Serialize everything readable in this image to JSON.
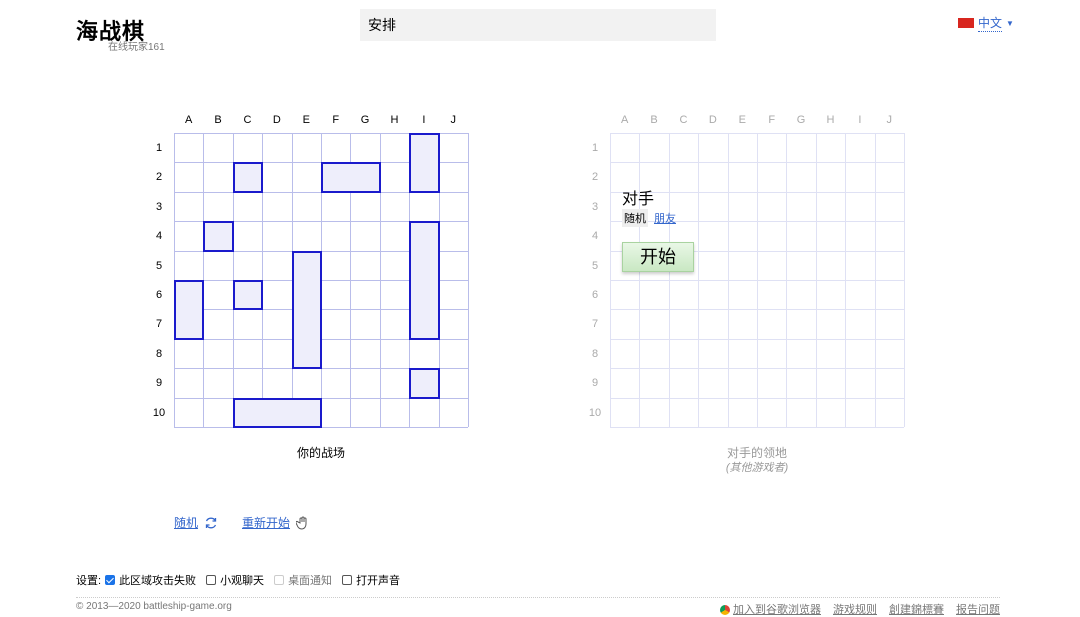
{
  "header": {
    "title": "海战棋",
    "online": "在线玩家161",
    "status": "安排",
    "language": "中文"
  },
  "boards": {
    "columns": [
      "A",
      "B",
      "C",
      "D",
      "E",
      "F",
      "G",
      "H",
      "I",
      "J"
    ],
    "rows": [
      "1",
      "2",
      "3",
      "4",
      "5",
      "6",
      "7",
      "8",
      "9",
      "10"
    ],
    "own_caption": "你的战场",
    "enemy_caption": "对手的领地",
    "enemy_sub": "(其他游戏者)",
    "ships": [
      {
        "col": "C",
        "row": 2,
        "len": 1,
        "dir": "h"
      },
      {
        "col": "F",
        "row": 2,
        "len": 2,
        "dir": "h"
      },
      {
        "col": "I",
        "row": 1,
        "len": 2,
        "dir": "v"
      },
      {
        "col": "B",
        "row": 4,
        "len": 1,
        "dir": "h"
      },
      {
        "col": "I",
        "row": 4,
        "len": 4,
        "dir": "v"
      },
      {
        "col": "E",
        "row": 5,
        "len": 4,
        "dir": "v"
      },
      {
        "col": "A",
        "row": 6,
        "len": 2,
        "dir": "v"
      },
      {
        "col": "C",
        "row": 6,
        "len": 1,
        "dir": "h"
      },
      {
        "col": "I",
        "row": 9,
        "len": 1,
        "dir": "h"
      },
      {
        "col": "C",
        "row": 10,
        "len": 3,
        "dir": "h"
      }
    ]
  },
  "opponent": {
    "label": "对手",
    "random": "随机",
    "friend": "朋友",
    "start": "开始"
  },
  "actions": {
    "random": "随机",
    "restart": "重新开始"
  },
  "settings": {
    "label": "设置:",
    "items": [
      {
        "label": "此区域攻击失败",
        "checked": true,
        "disabled": false
      },
      {
        "label": "小观聊天",
        "checked": false,
        "disabled": false
      },
      {
        "label": "桌面通知",
        "checked": false,
        "disabled": true
      },
      {
        "label": "打开声音",
        "checked": false,
        "disabled": false
      }
    ]
  },
  "footer": {
    "copyright": "© 2013—2020 battleship-game.org",
    "links": [
      "加入到谷歌浏览器",
      "游戏规则",
      "創建錦標賽",
      "报告问题"
    ]
  },
  "colors": {
    "ship_border": "#1a1acc",
    "ship_fill": "#eeeefb",
    "link": "#3366cc"
  }
}
